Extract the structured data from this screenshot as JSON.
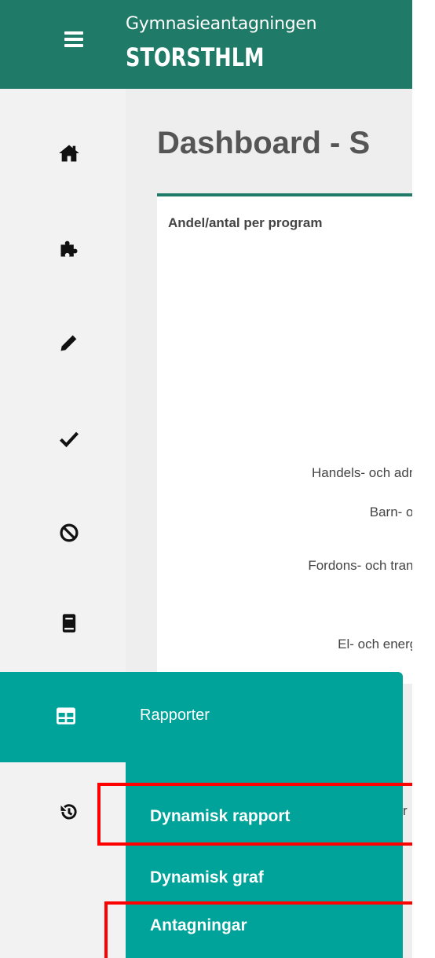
{
  "header": {
    "brand_line1": "Gymnasieantagningen",
    "brand_line2": "STORSTHLM"
  },
  "sidebar": {
    "icons": [
      "home-icon",
      "puzzle-icon",
      "pencil-icon",
      "check-icon",
      "ban-icon",
      "book-icon",
      "grid-icon",
      "history-icon"
    ]
  },
  "main": {
    "title": "Dashboard - S",
    "card": {
      "title": "Andel/antal per program",
      "labels": [
        "Handels- och adm",
        "Barn- oc",
        "Fordons- och trans",
        "El- och energi"
      ]
    }
  },
  "menu": {
    "label": "Rapporter",
    "items": [
      "Dynamisk rapport",
      "Dynamisk graf",
      "Antagningar"
    ],
    "behind_fragment": "r"
  },
  "colors": {
    "header": "#1f7a67",
    "menu": "#00a39a",
    "highlight": "#ff0000"
  }
}
